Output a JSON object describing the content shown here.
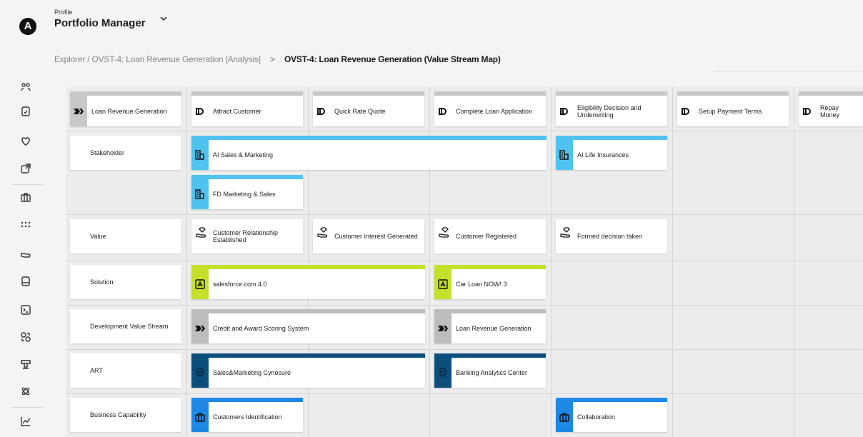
{
  "app": {
    "avatar_letter": "A"
  },
  "header": {
    "profile_label": "Profile",
    "profile_name": "Portfolio Manager"
  },
  "breadcrumb": {
    "parent": "Explorer / OVST-4: Loan Revenue Generation [Analysis]",
    "separator": ">",
    "current": "OVST-4: Loan Revenue Generation (Value Stream Map)"
  },
  "colors": {
    "stakeholder": "#4fc3f0",
    "solution": "#c6df2a",
    "dev_value_stream": "#bdbdbd",
    "art": "#0d4f7c",
    "capability": "#1e88e5",
    "stage_bar": "#c8c8c8"
  },
  "map": {
    "title": "Loan Revenue Generation",
    "stages": [
      "Attract Customer",
      "Quick Rate Quote",
      "Complete Loan Application",
      "Eligibility Decision and Underwriting",
      "Setup Payment Terms",
      "Repay Money"
    ],
    "row_labels": {
      "stakeholder": "Stakeholder",
      "value": "Value",
      "solution": "Solution",
      "dev_value_stream": "Development Value Stream",
      "art": "ART",
      "business_capability": "Business Capability"
    },
    "stakeholders": [
      "AI Sales & Marketing",
      "AI Life Insurances",
      "FD Marketing & Sales"
    ],
    "values": [
      "Customer Relationship Established",
      "Customer Interest Generated",
      "Customer Registered",
      "Formed decision taken"
    ],
    "solutions": [
      "salesforce.com 4.0",
      "Car Loan NOW! 3"
    ],
    "dev_value_streams": [
      "Credit and Award Scoring System",
      "Loan Revenue Generation"
    ],
    "arts": [
      "Sales&Marketing Cynosure",
      "Banking Analytics Center"
    ],
    "capabilities": [
      "Customers Identification",
      "Collaboration"
    ]
  }
}
